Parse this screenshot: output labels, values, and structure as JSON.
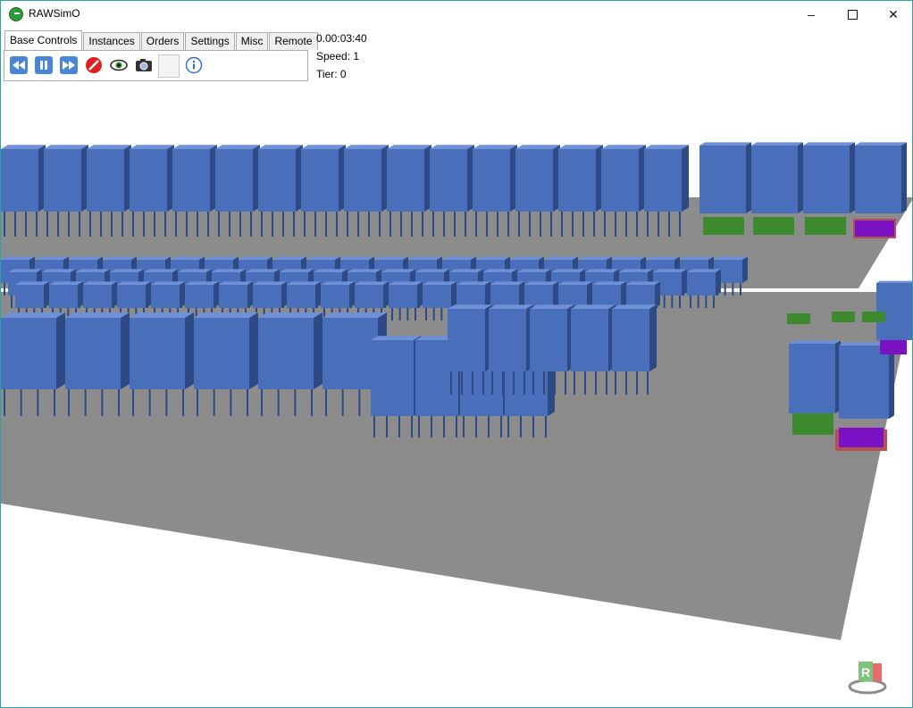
{
  "window": {
    "title": "RAWSimO"
  },
  "tabs": [
    {
      "label": "Base Controls",
      "active": true
    },
    {
      "label": "Instances"
    },
    {
      "label": "Orders"
    },
    {
      "label": "Settings"
    },
    {
      "label": "Misc"
    },
    {
      "label": "Remote"
    }
  ],
  "toolbar": {
    "buttons": [
      "rewind-icon",
      "pause-icon",
      "fast-forward-icon",
      "stop-icon",
      "eye-icon",
      "camera-icon",
      "blank-button",
      "info-icon"
    ]
  },
  "status": {
    "time": "0.00:03:40",
    "speed": "Speed: 1",
    "tier": "Tier: 0"
  },
  "logo": {
    "letter": "R"
  },
  "colors": {
    "pod_top": "#6f90d6",
    "pod_front": "#4a6fba",
    "pod_side": "#2e4a84",
    "floor": "#8c8c8c",
    "station_green": "#3d8a2e",
    "station_purple": "#7a12c4",
    "station_red": "#b55050",
    "accent": "#2fa3a3"
  }
}
